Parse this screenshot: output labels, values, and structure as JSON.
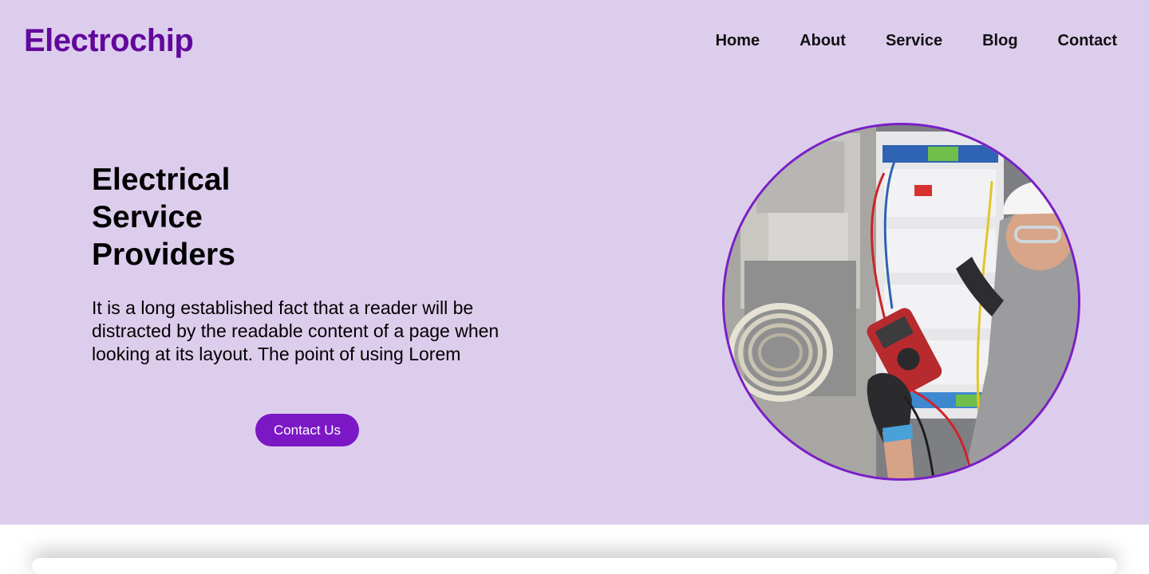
{
  "brand": {
    "name": "Electrochip",
    "color": "#62079c"
  },
  "nav": {
    "items": [
      {
        "label": "Home"
      },
      {
        "label": "About"
      },
      {
        "label": "Service"
      },
      {
        "label": "Blog"
      },
      {
        "label": "Contact"
      }
    ]
  },
  "hero": {
    "title_lines": [
      "Electrical",
      "Service",
      "Providers"
    ],
    "description": "It is a long established fact that a reader will be distracted by the readable content of a page when looking at its layout. The point of using Lorem",
    "cta_label": "Contact Us",
    "background": "#ddcded",
    "accent": "#7c17c6",
    "image_subject": "electrician-with-multimeter-at-panel"
  }
}
